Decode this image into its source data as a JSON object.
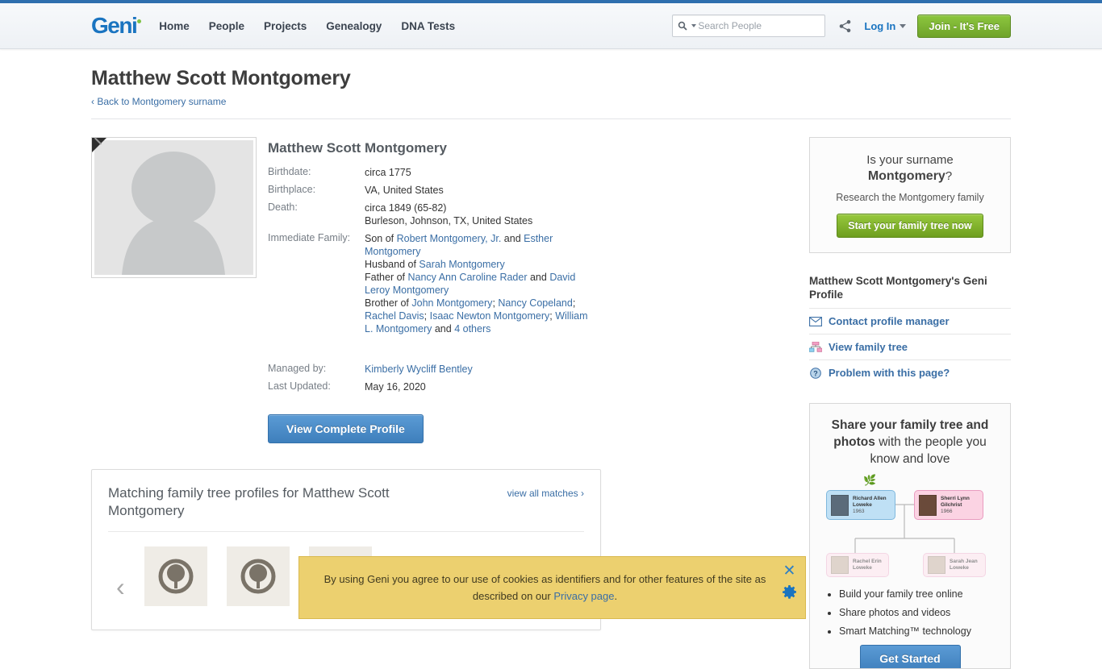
{
  "header": {
    "logo_text": "Geni",
    "nav": [
      {
        "label": "Home"
      },
      {
        "label": "People"
      },
      {
        "label": "Projects"
      },
      {
        "label": "Genealogy"
      },
      {
        "label": "DNA Tests"
      }
    ],
    "search": {
      "placeholder": "Search People",
      "value": ""
    },
    "share_icon": "share-icon",
    "login_label": "Log In",
    "join_label": "Join - It's Free"
  },
  "page": {
    "title": "Matthew Scott Montgomery",
    "back_link": "‹ Back to Montgomery surname"
  },
  "profile": {
    "name": "Matthew Scott Montgomery",
    "fields": {
      "birthdate_label": "Birthdate:",
      "birthdate_value": "circa 1775",
      "birthplace_label": "Birthplace:",
      "birthplace_value": "VA, United States",
      "death_label": "Death:",
      "death_value": "circa 1849 (65-82)",
      "death_place": "Burleson, Johnson, TX, United States",
      "family_label": "Immediate Family:",
      "managed_label": "Managed by:",
      "managed_value": "Kimberly Wycliff Bentley",
      "updated_label": "Last Updated:",
      "updated_value": "May 16, 2020"
    },
    "family": {
      "son_prefix": "Son of ",
      "father": "Robert Montgomery, Jr.",
      "and1": " and ",
      "mother": "Esther Montgomery",
      "husband_prefix": "Husband of ",
      "wife": "Sarah Montgomery",
      "father_prefix": "Father of ",
      "child1": "Nancy Ann Caroline Rader",
      "and2": " and ",
      "child2": "David Leroy Montgomery",
      "brother_prefix": "Brother of ",
      "sib1": "John Montgomery",
      "sep1": "; ",
      "sib2": "Nancy Copeland",
      "sep2": "; ",
      "sib3": "Rachel Davis",
      "sep3": "; ",
      "sib4": "Isaac Newton Montgomery",
      "sep4": "; ",
      "sib5": "William L. Montgomery",
      "and3": " and ",
      "others": "4 others"
    },
    "view_complete_profile": "View Complete Profile"
  },
  "matches": {
    "title": "Matching family tree profiles for Matthew Scott Montgomery",
    "view_all": "view all matches ›",
    "prev_arrow": "‹",
    "thumb_count": 3
  },
  "sidebar": {
    "surname_box": {
      "line1": "Is your surname",
      "surname": "Montgomery",
      "q": "?",
      "line2": "Research the Montgomery family",
      "button": "Start your family tree now"
    },
    "geni_profile": {
      "title": "Matthew Scott Montgomery's Geni Profile",
      "links": [
        {
          "label": "Contact profile manager",
          "icon": "envelope-icon"
        },
        {
          "label": "View family tree",
          "icon": "family-tree-icon"
        },
        {
          "label": "Problem with this page?",
          "icon": "question-circle-icon"
        }
      ]
    },
    "share_box": {
      "heading_bold1": "Share your family tree and photos",
      "heading_rest": " with the people you know and love",
      "nodes": [
        {
          "name": "Richard Allen Loweke",
          "year": "1963",
          "color": "blue"
        },
        {
          "name": "Sherri Lynn Gilchrist",
          "year": "1966",
          "color": "pink"
        },
        {
          "name": "Rachel Erin Loweke",
          "year": "",
          "color": "pink2"
        },
        {
          "name": "Sarah Jean Loweke",
          "year": "",
          "color": "pink2"
        }
      ],
      "bullets": [
        "Build your family tree online",
        "Share photos and videos",
        "Smart Matching™ technology"
      ],
      "button": "Get Started"
    }
  },
  "cookie": {
    "text_part1": "By using Geni you agree to our use of cookies as identifiers and for other features of the site as described on our ",
    "link": "Privacy page",
    "text_part2": ".",
    "close_icon": "close-icon",
    "settings_icon": "gear-icon"
  },
  "colors": {
    "accent_blue": "#3a6ea5",
    "brand_blue": "#1a74c0",
    "green": "#7ec243",
    "cookie_bg": "#ecd06f"
  }
}
